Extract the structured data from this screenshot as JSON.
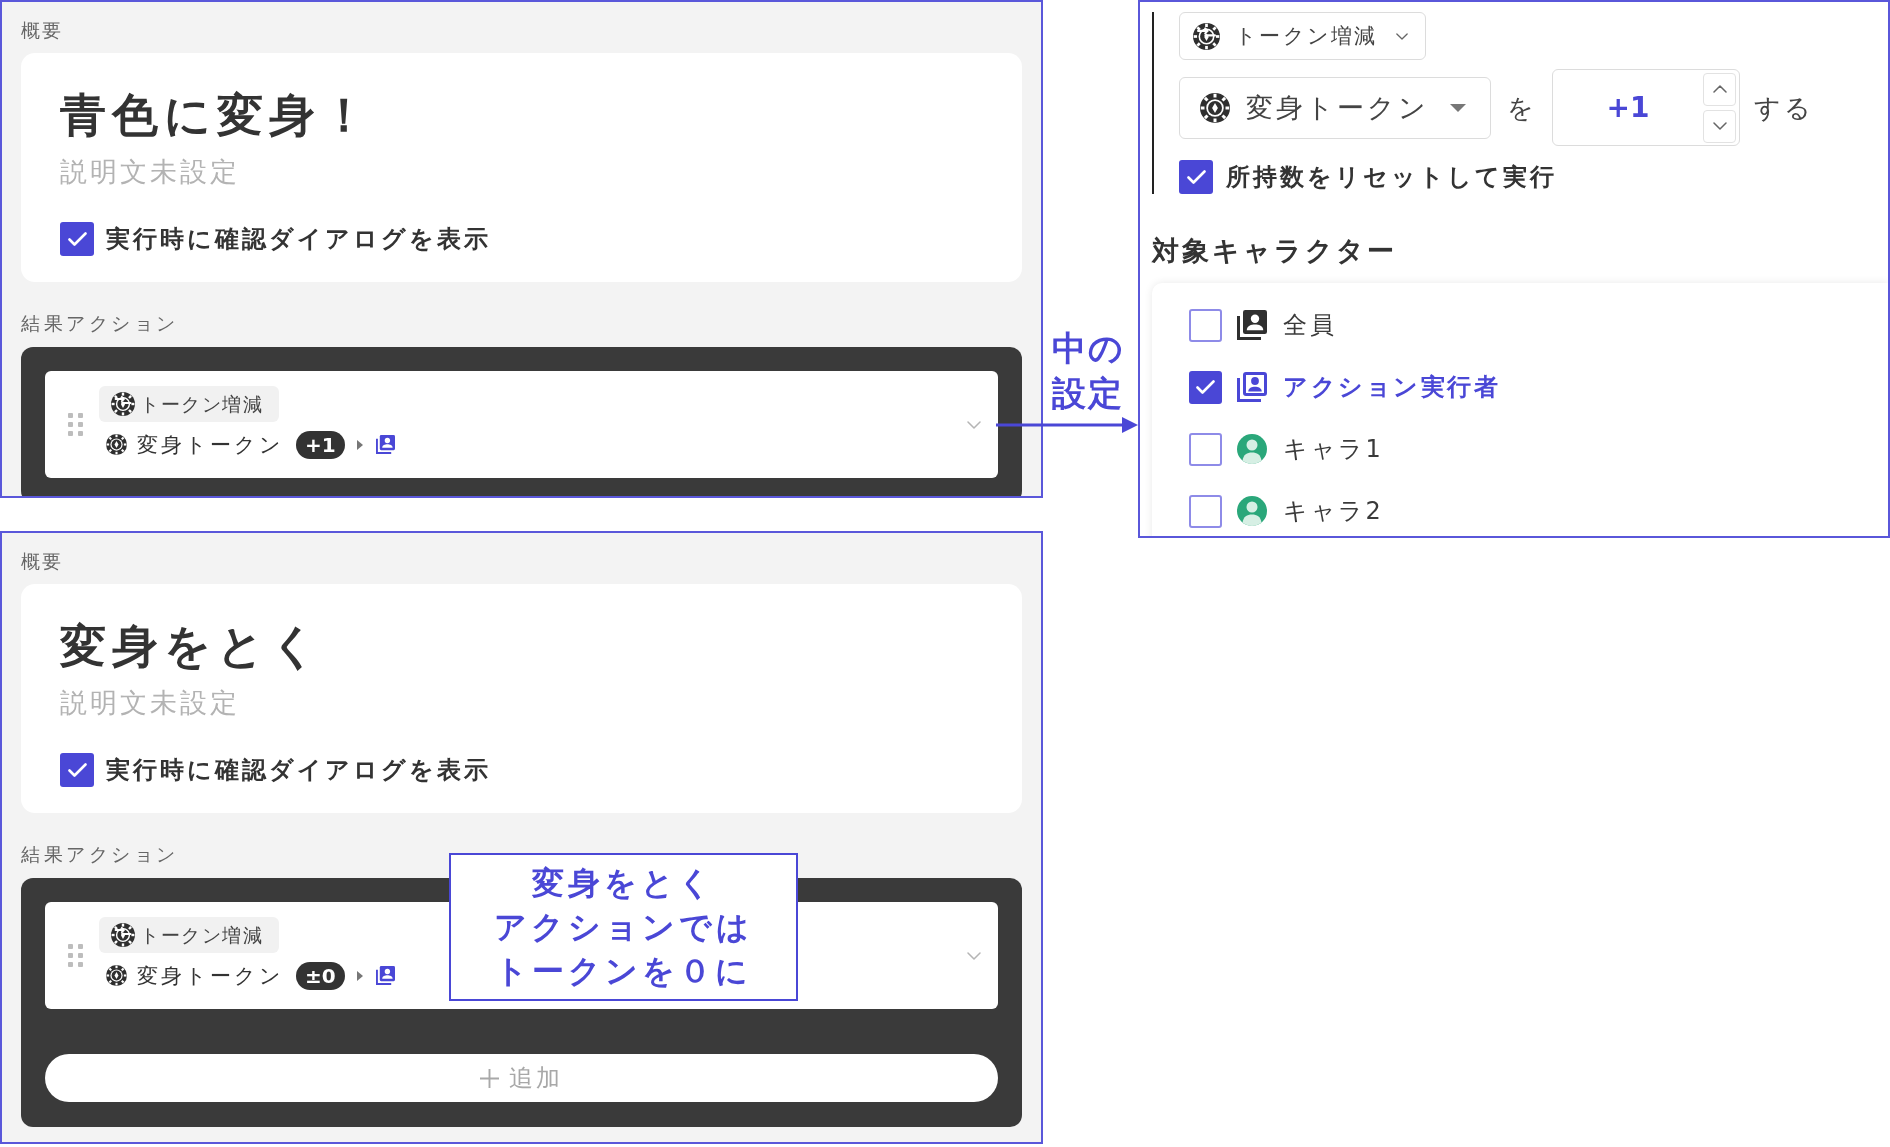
{
  "summary_panels": [
    {
      "section_label": "概要",
      "title": "青色に変身！",
      "description": "説明文未設定",
      "confirm_option": {
        "label": "実行時に確認ダイアログを表示",
        "checked": true
      },
      "results_label": "結果アクション",
      "result_actions": [
        {
          "type_label": "トークン増減",
          "token": "変身トークン",
          "amount": "+1"
        }
      ]
    },
    {
      "section_label": "概要",
      "title": "変身をとく",
      "description": "説明文未設定",
      "confirm_option": {
        "label": "実行時に確認ダイアログを表示",
        "checked": true
      },
      "results_label": "結果アクション",
      "result_actions": [
        {
          "type_label": "トークン増減",
          "token": "変身トークン",
          "amount": "±0"
        }
      ],
      "add_button": "追加"
    }
  ],
  "action_detail": {
    "action_type": "トークン増減",
    "token": "変身トークン",
    "particle": "を",
    "amount": "+1",
    "verb": "する",
    "reset_option": {
      "label": "所持数をリセットして実行",
      "checked": true
    },
    "targets_heading": "対象キャラクター",
    "targets": [
      {
        "kind": "everyone",
        "label": "全員",
        "checked": false
      },
      {
        "kind": "executor",
        "label": "アクション実行者",
        "checked": true
      },
      {
        "kind": "character",
        "label": "キャラ1",
        "checked": false
      },
      {
        "kind": "character",
        "label": "キャラ2",
        "checked": false
      }
    ]
  },
  "annotations": [
    {
      "kind": "arrow",
      "text": "中の設定"
    },
    {
      "kind": "callout",
      "lines": [
        "変身をとく",
        "アクションでは",
        "トークンを０に"
      ]
    }
  ]
}
